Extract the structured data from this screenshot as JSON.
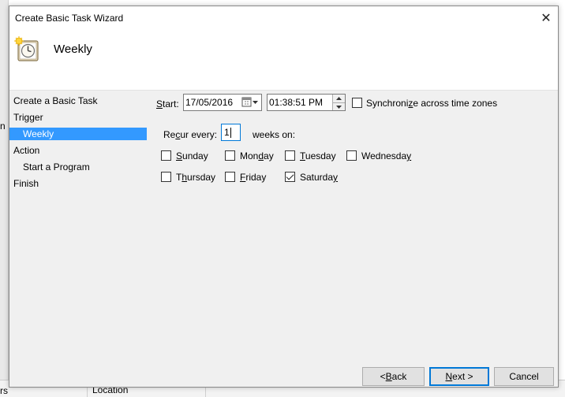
{
  "background": {
    "frag_left_top": "n",
    "frag_left_bottom": "rs",
    "frag_bottom_col": "Location"
  },
  "dialog": {
    "title": "Create Basic Task Wizard",
    "close_glyph": "✕",
    "header_title": "Weekly",
    "steps": [
      {
        "label": "Create a Basic Task",
        "selected": false
      },
      {
        "label": "Trigger",
        "selected": false
      },
      {
        "label": "Weekly",
        "selected": true
      },
      {
        "label": "Action",
        "selected": false
      },
      {
        "label": "Start a Program",
        "selected": false
      },
      {
        "label": "Finish",
        "selected": false
      }
    ]
  },
  "trigger": {
    "start_label_u": "S",
    "start_label_rest": "tart:",
    "date_value": "17/05/2016",
    "time_value": "01:38:51 PM",
    "sync_label_pre": "Synchroni",
    "sync_label_u": "z",
    "sync_label_post": "e across time zones",
    "sync_checked": false,
    "recur_label_pre": "Re",
    "recur_label_u": "c",
    "recur_label_post": "ur every:",
    "recur_value": "1",
    "weeks_on_label": "weeks on:",
    "days": [
      {
        "pre": "",
        "u": "S",
        "post": "unday",
        "checked": false
      },
      {
        "pre": "Mon",
        "u": "d",
        "post": "ay",
        "checked": false
      },
      {
        "pre": "",
        "u": "T",
        "post": "uesday",
        "checked": false
      },
      {
        "pre": "Wednesda",
        "u": "y",
        "post": "",
        "checked": false
      },
      {
        "pre": "T",
        "u": "h",
        "post": "ursday",
        "checked": false
      },
      {
        "pre": "",
        "u": "F",
        "post": "riday",
        "checked": false
      },
      {
        "pre": "Saturda",
        "u": "y",
        "post": "",
        "checked": true
      }
    ]
  },
  "buttons": {
    "back_pre": "< ",
    "back_u": "B",
    "back_post": "ack",
    "next_u": "N",
    "next_post": "ext >",
    "cancel": "Cancel"
  },
  "colors": {
    "selection": "#3399ff",
    "focus_border": "#0078d7",
    "dialog_bg": "#f0f0f0"
  }
}
